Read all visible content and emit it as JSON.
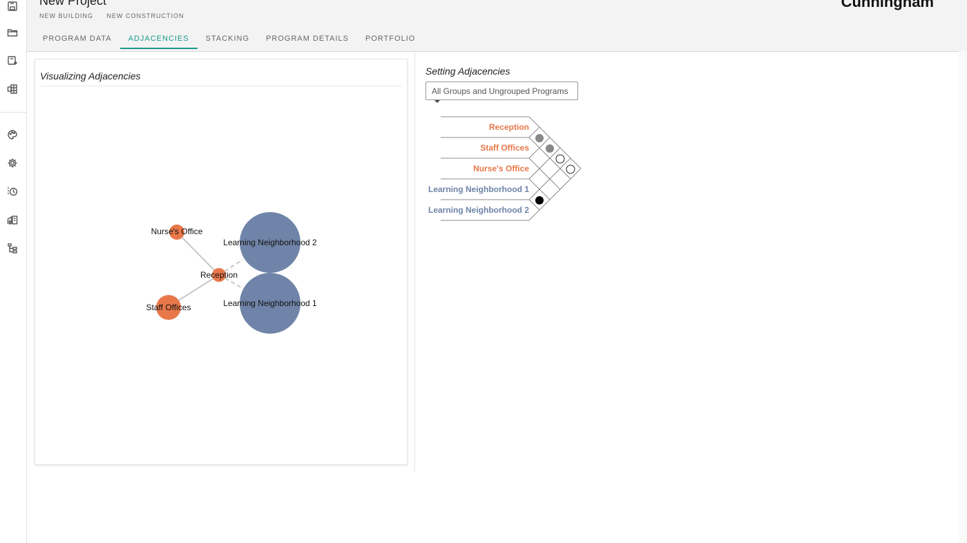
{
  "header": {
    "title": "New Project",
    "subtags": [
      "NEW BUILDING",
      "NEW CONSTRUCTION"
    ],
    "brand": "Cunningham"
  },
  "tabs": [
    {
      "label": "PROGRAM DATA",
      "active": false
    },
    {
      "label": "ADJACENCIES",
      "active": true
    },
    {
      "label": "STACKING",
      "active": false
    },
    {
      "label": "PROGRAM DETAILS",
      "active": false
    },
    {
      "label": "PORTFOLIO",
      "active": false
    }
  ],
  "rail_icons": [
    "save-icon",
    "folder-icon",
    "save-as-icon",
    "export-excel-icon",
    "palette-icon",
    "gear-icon",
    "history-icon",
    "building-icon",
    "hierarchy-icon"
  ],
  "visualizing": {
    "title": "Visualizing Adjacencies",
    "nodes": [
      {
        "label": "Nurse's Office",
        "color": "#e8784a"
      },
      {
        "label": "Reception",
        "color": "#e8784a"
      },
      {
        "label": "Staff Offices",
        "color": "#e8784a"
      },
      {
        "label": "Learning Neighborhood 2",
        "color": "#6f84a8"
      },
      {
        "label": "Learning Neighborhood 1",
        "color": "#6f84a8"
      }
    ]
  },
  "setting": {
    "title": "Setting Adjacencies",
    "dropdown_value": "All Groups and Ungrouped Programs",
    "programs": [
      {
        "label": "Reception",
        "color": "#e8784a"
      },
      {
        "label": "Staff Offices",
        "color": "#e8784a"
      },
      {
        "label": "Nurse's Office",
        "color": "#e8784a"
      },
      {
        "label": "Learning Neighborhood 1",
        "color": "#6f84a8"
      },
      {
        "label": "Learning Neighborhood 2",
        "color": "#6f84a8"
      }
    ]
  },
  "colors": {
    "accent": "#1a9a8c",
    "program_orange": "#e8784a",
    "group_blue": "#6f84a8"
  }
}
